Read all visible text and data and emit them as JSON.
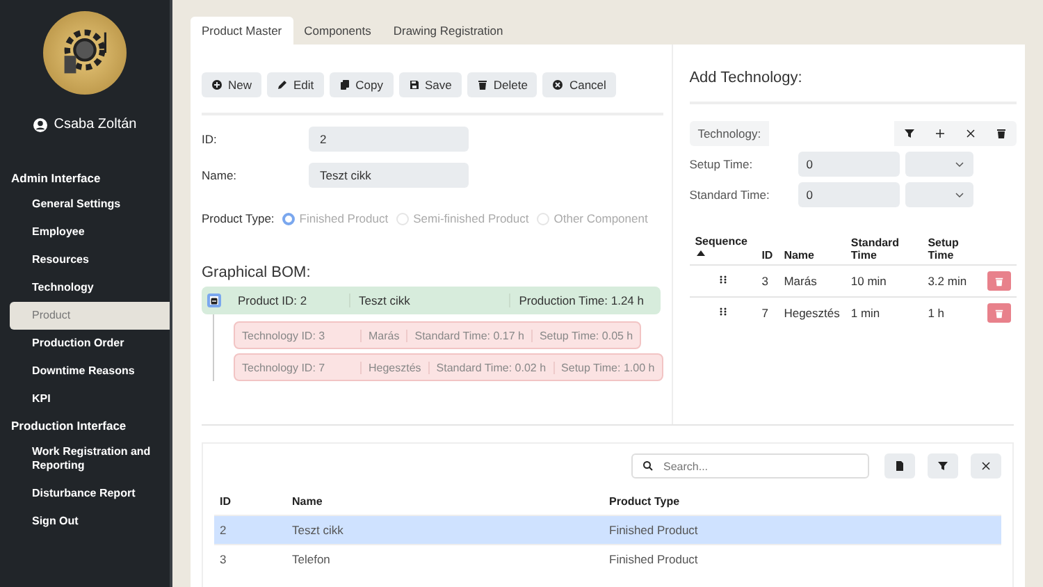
{
  "sidebar": {
    "user": "Csaba Zoltán",
    "sections": [
      {
        "title": "Admin Interface",
        "items": [
          {
            "label": "General Settings",
            "selected": false
          },
          {
            "label": "Employee",
            "selected": false
          },
          {
            "label": "Resources",
            "selected": false
          },
          {
            "label": "Technology",
            "selected": false
          },
          {
            "label": "Product",
            "selected": true
          },
          {
            "label": "Production Order",
            "selected": false
          },
          {
            "label": "Downtime Reasons",
            "selected": false
          },
          {
            "label": "KPI",
            "selected": false
          }
        ]
      },
      {
        "title": "Production Interface",
        "items": [
          {
            "label": "Work Registration and Reporting",
            "selected": false
          },
          {
            "label": "Disturbance Report",
            "selected": false
          },
          {
            "label": "Sign Out",
            "selected": false
          }
        ]
      }
    ]
  },
  "tabs": [
    {
      "label": "Product Master",
      "selected": true
    },
    {
      "label": "Components",
      "selected": false
    },
    {
      "label": "Drawing Registration",
      "selected": false
    }
  ],
  "toolbar": [
    {
      "label": "New",
      "kind": "new"
    },
    {
      "label": "Edit",
      "kind": "edit"
    },
    {
      "label": "Copy",
      "kind": "copy"
    },
    {
      "label": "Save",
      "kind": "save"
    },
    {
      "label": "Delete",
      "kind": "delete"
    },
    {
      "label": "Cancel",
      "kind": "cancel"
    }
  ],
  "form": {
    "fields": [
      {
        "label": "ID:",
        "value": "2"
      },
      {
        "label": "Name:",
        "value": "Teszt cikk"
      }
    ],
    "product_type": {
      "label": "Product Type:",
      "options": [
        {
          "label": "Finished Product",
          "selected": true
        },
        {
          "label": "Semi-finished Product",
          "selected": false
        },
        {
          "label": "Other Component",
          "selected": false
        }
      ]
    }
  },
  "bom": {
    "title": "Graphical BOM:",
    "root": {
      "expanded": true,
      "id_label": "Product ID:",
      "id": "2",
      "name": "Teszt cikk",
      "time_label": "Production Time:",
      "time": "1.24 h",
      "children": [
        {
          "id_label": "Technology ID:",
          "id": "3",
          "name": "Marás",
          "standard_label": "Standard Time:",
          "standard": "0.17 h",
          "setup_label": "Setup Time:",
          "setup": "0.05 h"
        },
        {
          "id_label": "Technology ID:",
          "id": "7",
          "name": "Hegesztés",
          "standard_label": "Standard Time:",
          "standard": "0.02 h",
          "setup_label": "Setup Time:",
          "setup": "1.00 h"
        }
      ]
    }
  },
  "add_technology": {
    "title": "Add Technology:",
    "technology_label": "Technology:",
    "times": [
      {
        "label": "Setup Time:",
        "value": "0"
      },
      {
        "label": "Standard Time:",
        "value": "0"
      }
    ],
    "columns": [
      "Sequence",
      "ID",
      "Name",
      "Standard Time",
      "Setup Time"
    ],
    "rows": [
      {
        "id": "3",
        "name": "Marás",
        "standard": "10 min",
        "setup": "3.2 min"
      },
      {
        "id": "7",
        "name": "Hegesztés",
        "standard": "1 min",
        "setup": "1 h"
      }
    ]
  },
  "products": {
    "search": {
      "placeholder": "Search..."
    },
    "columns": [
      "ID",
      "Name",
      "Product Type"
    ],
    "rows": [
      {
        "id": "2",
        "name": "Teszt cikk",
        "type": "Finished Product",
        "selected": true
      },
      {
        "id": "3",
        "name": "Telefon",
        "type": "Finished Product",
        "selected": false
      }
    ]
  }
}
